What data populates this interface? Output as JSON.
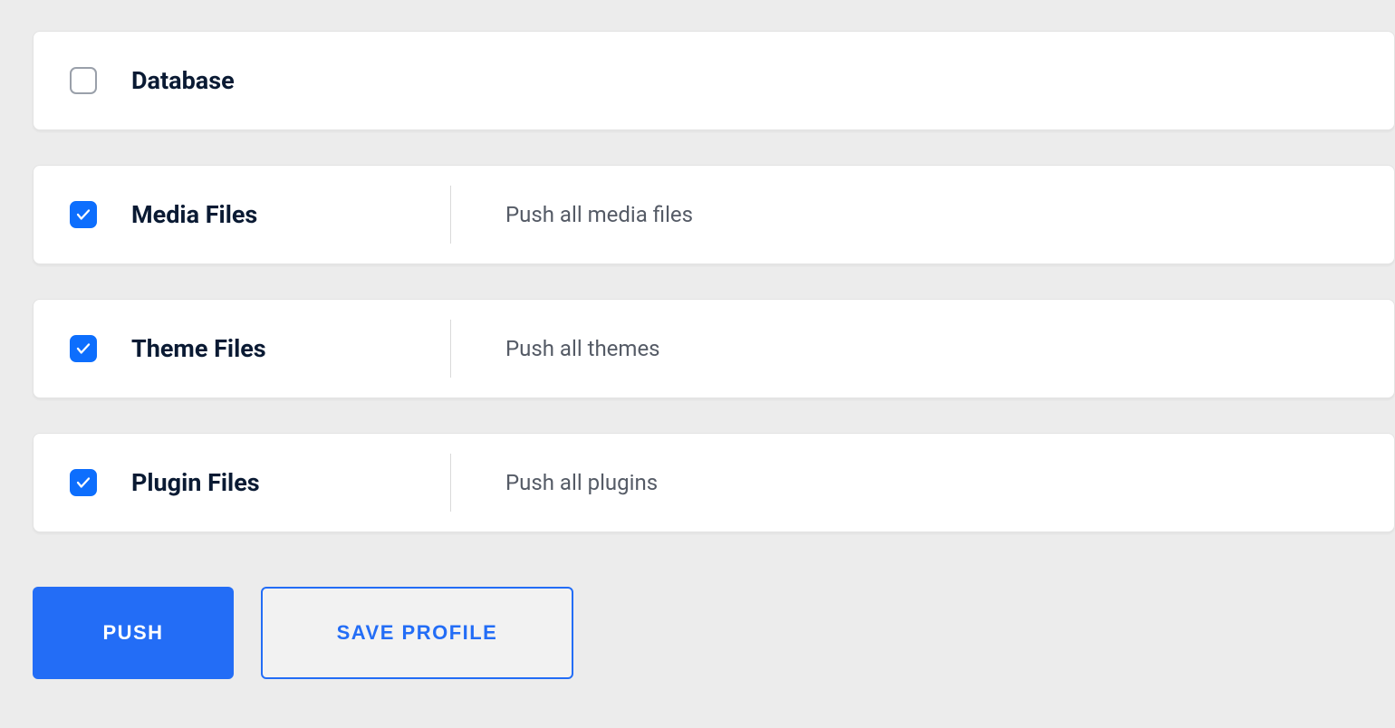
{
  "options": [
    {
      "label": "Database",
      "description": "",
      "checked": false
    },
    {
      "label": "Media Files",
      "description": "Push all media files",
      "checked": true
    },
    {
      "label": "Theme Files",
      "description": "Push all themes",
      "checked": true
    },
    {
      "label": "Plugin Files",
      "description": "Push all plugins",
      "checked": true
    }
  ],
  "buttons": {
    "primary": "Push",
    "secondary": "Save Profile"
  }
}
